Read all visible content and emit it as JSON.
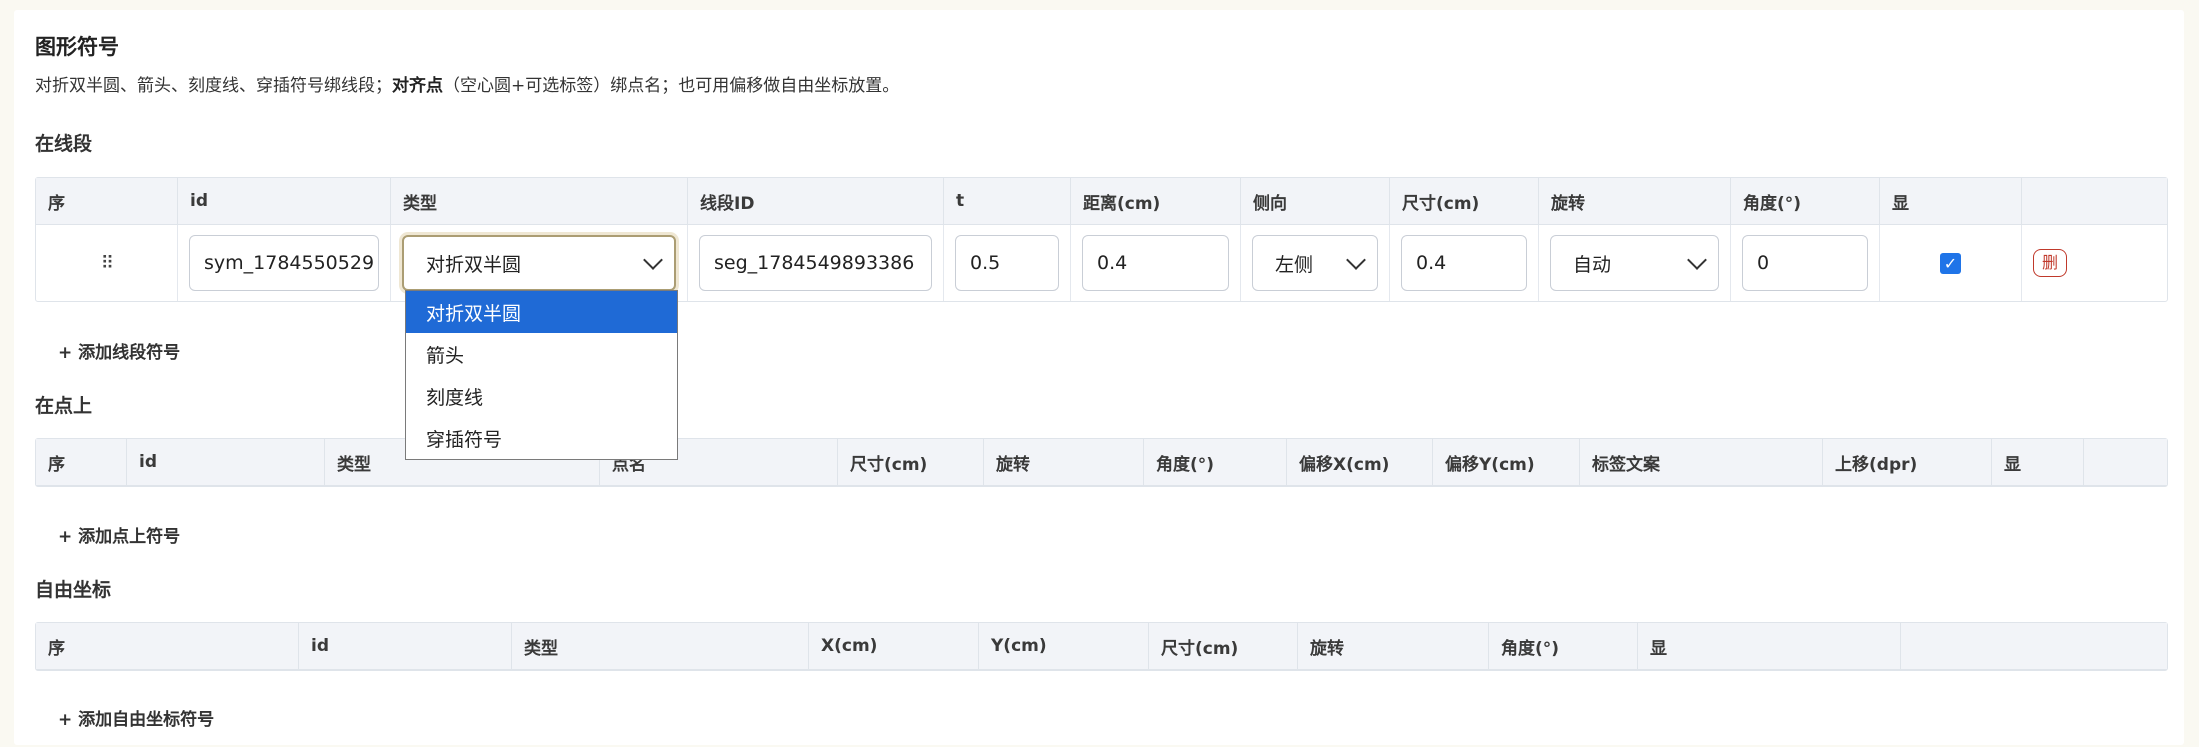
{
  "header": {
    "title": "图形符号",
    "desc_a": "对折双半圆、箭头、刻度线、穿插符号绑线段；",
    "desc_b": "对齐点",
    "desc_c": "（空心圆+可选标签）绑点名；也可用偏移做自由坐标放置。"
  },
  "segment_section": {
    "title": "在线段",
    "columns": [
      "序",
      "id",
      "类型",
      "线段ID",
      "t",
      "距离(cm)",
      "侧向",
      "尺寸(cm)",
      "旋转",
      "角度(°)",
      "显",
      ""
    ],
    "row": {
      "drag_handle": "⠿",
      "id": "sym_1784550529",
      "type": "对折双半圆",
      "segment_id": "seg_1784549893386",
      "t": "0.5",
      "distance": "0.4",
      "side": "左侧",
      "size": "0.4",
      "rotation": "自动",
      "angle": "0",
      "visible": true,
      "delete_label": "删"
    },
    "add_label": "+  添加线段符号"
  },
  "type_dropdown": {
    "options": [
      "对折双半圆",
      "箭头",
      "刻度线",
      "穿插符号"
    ],
    "selected": "对折双半圆"
  },
  "point_section": {
    "title": "在点上",
    "columns": [
      "序",
      "id",
      "类型",
      "点名",
      "尺寸(cm)",
      "旋转",
      "角度(°)",
      "偏移X(cm)",
      "偏移Y(cm)",
      "标签文案",
      "上移(dpr)",
      "显",
      ""
    ],
    "add_label": "+  添加点上符号"
  },
  "free_section": {
    "title": "自由坐标",
    "columns": [
      "序",
      "id",
      "类型",
      "X(cm)",
      "Y(cm)",
      "尺寸(cm)",
      "旋转",
      "角度(°)",
      "显",
      ""
    ],
    "add_label": "+  添加自由坐标符号"
  },
  "colors": {
    "accent": "#1f6ad6",
    "delete": "#c0392b",
    "focus_border": "#ab9d73",
    "header_bg": "#f2f4f8"
  }
}
